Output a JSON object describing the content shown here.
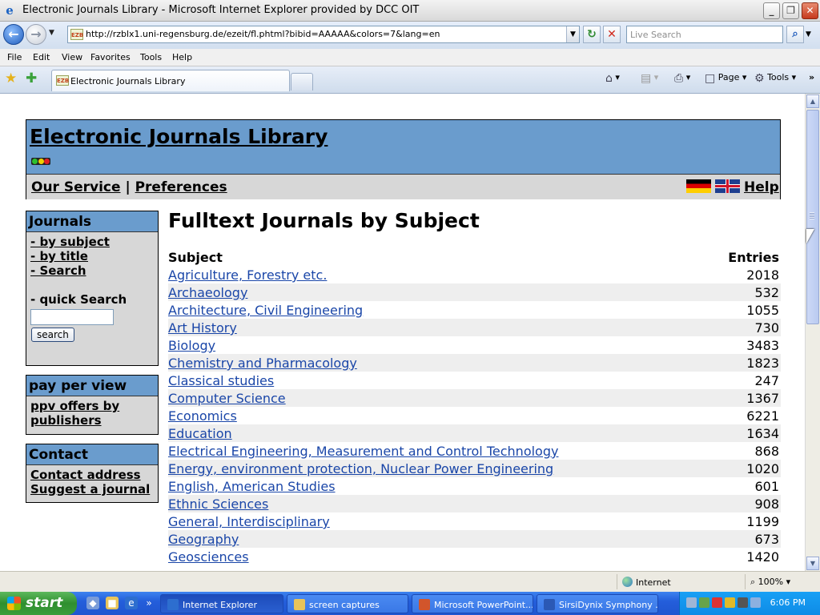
{
  "window": {
    "title": "Electronic Journals Library - Microsoft Internet Explorer provided by DCC OIT",
    "minimize": "_",
    "maximize": "❐",
    "close": "✕"
  },
  "address_bar": {
    "favicon_text": "EZB",
    "url": "http://rzblx1.uni-regensburg.de/ezeit/fl.phtml?bibid=AAAAA&colors=7&lang=en",
    "search_placeholder": "Live Search"
  },
  "menu": [
    "File",
    "Edit",
    "View",
    "Favorites",
    "Tools",
    "Help"
  ],
  "tab": {
    "label": "Electronic Journals Library"
  },
  "command_bar": {
    "page_label": "Page",
    "tools_label": "Tools"
  },
  "page": {
    "site_title": "Electronic Journals Library",
    "nav": {
      "our_service": "Our Service",
      "separator": "|",
      "preferences": "Preferences",
      "help": "Help"
    },
    "sidebar": {
      "journals": {
        "heading": "Journals",
        "links": [
          "- by subject",
          "- by title",
          "- Search"
        ],
        "quick_search_label": "- quick Search",
        "search_button": "search"
      },
      "ppv": {
        "heading": "pay per view",
        "link": "ppv offers by publishers"
      },
      "contact": {
        "heading": "Contact",
        "links": [
          "Contact address",
          "Suggest a journal"
        ]
      }
    },
    "main": {
      "title": "Fulltext Journals by Subject",
      "col_subject": "Subject",
      "col_entries": "Entries",
      "rows": [
        {
          "subject": "Agriculture, Forestry etc.",
          "entries": "2018"
        },
        {
          "subject": "Archaeology",
          "entries": "532"
        },
        {
          "subject": "Architecture, Civil Engineering",
          "entries": "1055"
        },
        {
          "subject": "Art History",
          "entries": "730"
        },
        {
          "subject": "Biology",
          "entries": "3483"
        },
        {
          "subject": "Chemistry and Pharmacology",
          "entries": "1823"
        },
        {
          "subject": "Classical studies",
          "entries": "247"
        },
        {
          "subject": "Computer Science",
          "entries": "1367"
        },
        {
          "subject": "Economics",
          "entries": "6221"
        },
        {
          "subject": "Education",
          "entries": "1634"
        },
        {
          "subject": "Electrical Engineering, Measurement and Control Technology",
          "entries": "868"
        },
        {
          "subject": "Energy, environment protection, Nuclear Power Engineering",
          "entries": "1020"
        },
        {
          "subject": "English, American Studies",
          "entries": "601"
        },
        {
          "subject": "Ethnic Sciences",
          "entries": "908"
        },
        {
          "subject": "General, Interdisciplinary",
          "entries": "1199"
        },
        {
          "subject": "Geography",
          "entries": "673"
        },
        {
          "subject": "Geosciences",
          "entries": "1420"
        }
      ]
    }
  },
  "status_bar": {
    "zone": "Internet",
    "zoom": "100%"
  },
  "taskbar": {
    "start": "start",
    "buttons": [
      {
        "label": "Internet Explorer",
        "active": true
      },
      {
        "label": "screen captures",
        "active": false
      },
      {
        "label": "Microsoft PowerPoint...",
        "active": false
      },
      {
        "label": "SirsiDynix Symphony ...",
        "active": false
      }
    ],
    "clock": "6:06 PM"
  },
  "colors": {
    "header_blue": "#6a9ccd",
    "panel_gray": "#d7d7d7",
    "link_blue": "#1a46a8",
    "row_alt": "#eeeeee"
  }
}
